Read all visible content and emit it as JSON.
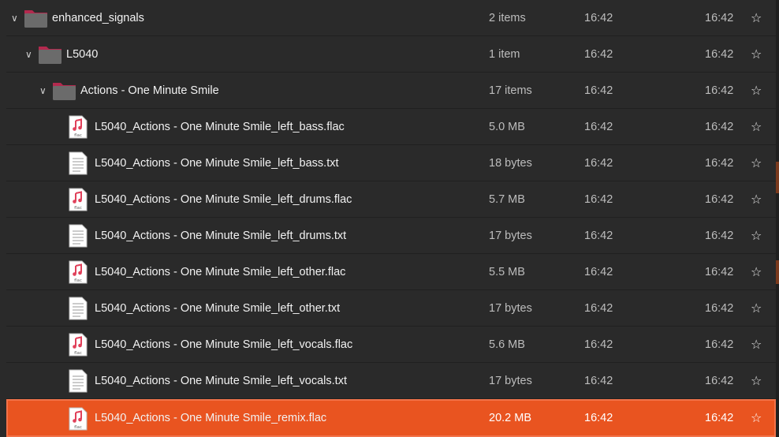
{
  "rows": [
    {
      "name": "enhanced_signals",
      "size": "2 items",
      "modified": "16:42",
      "accessed": "16:42",
      "type": "folder",
      "level": 0
    },
    {
      "name": "L5040",
      "size": "1 item",
      "modified": "16:42",
      "accessed": "16:42",
      "type": "folder",
      "level": 1
    },
    {
      "name": "Actions - One Minute Smile",
      "size": "17 items",
      "modified": "16:42",
      "accessed": "16:42",
      "type": "folder",
      "level": 2
    },
    {
      "name": "L5040_Actions - One Minute Smile_left_bass.flac",
      "size": "5.0 MB",
      "modified": "16:42",
      "accessed": "16:42",
      "type": "flac"
    },
    {
      "name": "L5040_Actions - One Minute Smile_left_bass.txt",
      "size": "18 bytes",
      "modified": "16:42",
      "accessed": "16:42",
      "type": "txt"
    },
    {
      "name": "L5040_Actions - One Minute Smile_left_drums.flac",
      "size": "5.7 MB",
      "modified": "16:42",
      "accessed": "16:42",
      "type": "flac"
    },
    {
      "name": "L5040_Actions - One Minute Smile_left_drums.txt",
      "size": "17 bytes",
      "modified": "16:42",
      "accessed": "16:42",
      "type": "txt"
    },
    {
      "name": "L5040_Actions - One Minute Smile_left_other.flac",
      "size": "5.5 MB",
      "modified": "16:42",
      "accessed": "16:42",
      "type": "flac"
    },
    {
      "name": "L5040_Actions - One Minute Smile_left_other.txt",
      "size": "17 bytes",
      "modified": "16:42",
      "accessed": "16:42",
      "type": "txt"
    },
    {
      "name": "L5040_Actions - One Minute Smile_left_vocals.flac",
      "size": "5.6 MB",
      "modified": "16:42",
      "accessed": "16:42",
      "type": "flac"
    },
    {
      "name": "L5040_Actions - One Minute Smile_left_vocals.txt",
      "size": "17 bytes",
      "modified": "16:42",
      "accessed": "16:42",
      "type": "txt"
    },
    {
      "name": "L5040_Actions - One Minute Smile_remix.flac",
      "size": "20.2 MB",
      "modified": "16:42",
      "accessed": "16:42",
      "type": "flac",
      "selected": true
    }
  ],
  "flac_label": "flac",
  "colors": {
    "selection": "#e95420",
    "background": "#2a2a2a",
    "flac_accent": "#e0405a"
  }
}
